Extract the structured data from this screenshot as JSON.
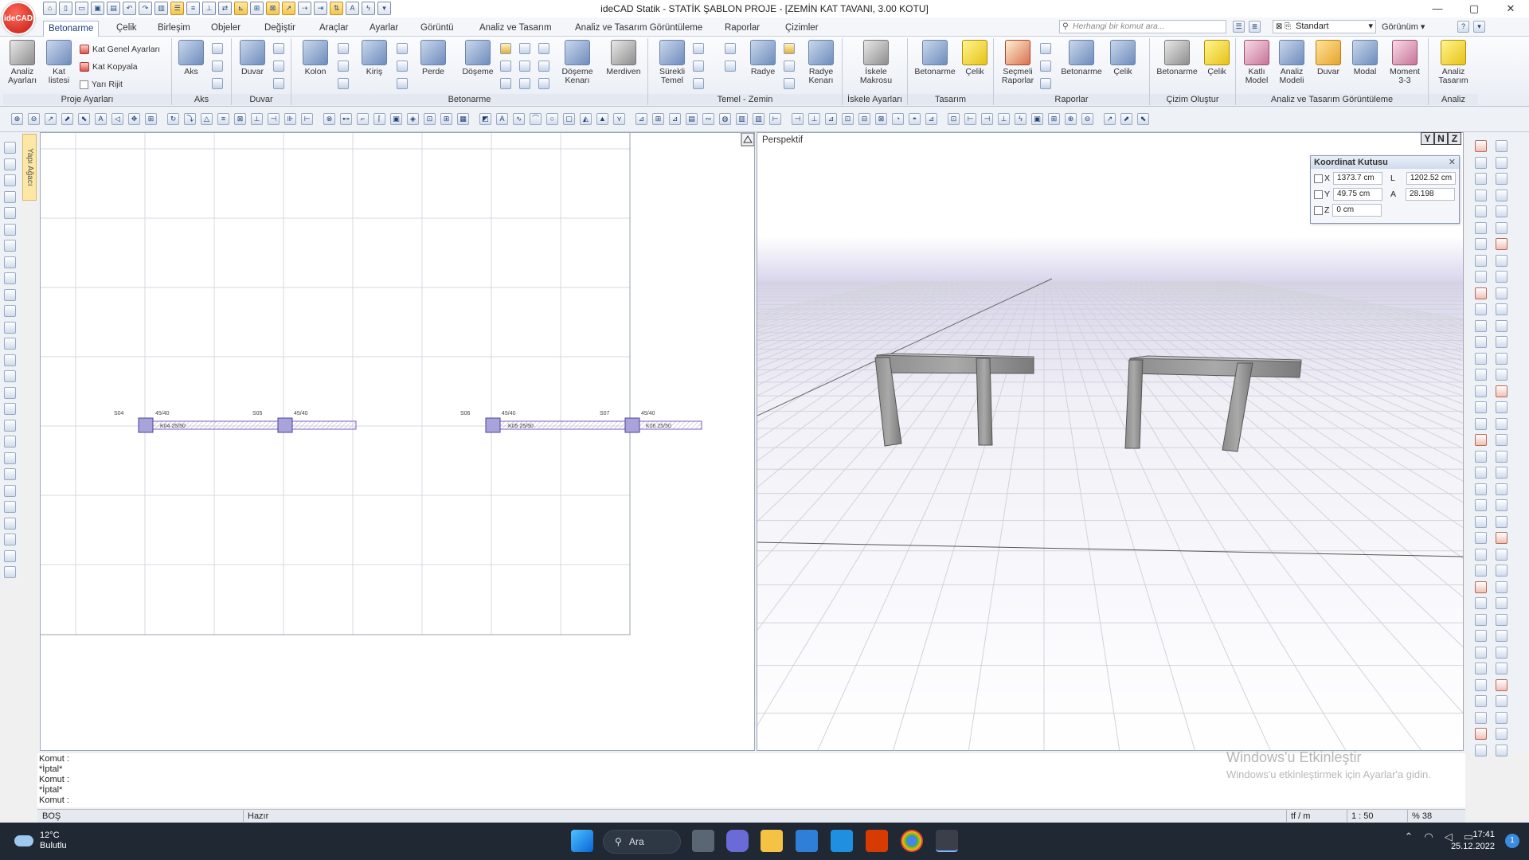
{
  "app": {
    "logo": "ideCAD",
    "title": "ideCAD Statik - STATİK ŞABLON PROJE - [ZEMİN KAT TAVANI,  3.00 KOTU]",
    "window_controls": [
      "—",
      "▢",
      "✕"
    ]
  },
  "tabs": [
    "Betonarme",
    "Çelik",
    "Birleşim",
    "Objeler",
    "Değiştir",
    "Araçlar",
    "Ayarlar",
    "Görüntü",
    "Analiz ve Tasarım",
    "Analiz ve Tasarım Görüntüleme",
    "Raporlar",
    "Çizimler"
  ],
  "search": {
    "placeholder": "Herhangi bir komut ara..."
  },
  "style_dropdown": {
    "value": "Standart"
  },
  "view_menu": {
    "label": "Görünüm"
  },
  "ribbon": {
    "proje": {
      "label": "Proje Ayarları",
      "analiz_ayarlari": [
        "Analiz",
        "Ayarları"
      ],
      "kat_listesi": [
        "Kat",
        "listesi"
      ],
      "kat_genel": "Kat Genel Ayarları",
      "kat_kopyala": "Kat Kopyala",
      "yari_rijit": "Yarı Rijit"
    },
    "aks": {
      "label": "Aks",
      "button": "Aks"
    },
    "duvar": {
      "label": "Duvar",
      "button": "Duvar"
    },
    "betonarme": {
      "label": "Betonarme",
      "kolon": "Kolon",
      "kiris": "Kiriş",
      "perde": "Perde",
      "doseme": "Döşeme",
      "doseme_kenari": [
        "Döşeme",
        "Kenarı"
      ],
      "merdiven": "Merdiven"
    },
    "temel": {
      "label": "Temel - Zemin",
      "surekli_temel": [
        "Sürekli",
        "Temel"
      ],
      "radye": "Radye",
      "radye_kenari": [
        "Radye",
        "Kenarı"
      ]
    },
    "iskele": {
      "label": "İskele Ayarları",
      "button": [
        "İskele",
        "Makrosu"
      ]
    },
    "tasarim": {
      "label": "Tasarım",
      "betonarme": "Betonarme",
      "celik": "Çelik"
    },
    "raporlar": {
      "label": "Raporlar",
      "secmeli": [
        "Seçmeli",
        "Raporlar"
      ],
      "betonarme": "Betonarme",
      "celik": "Çelik"
    },
    "cizim": {
      "label": "Çizim Oluştur",
      "betonarme": "Betonarme",
      "celik": "Çelik"
    },
    "analiz_gor": {
      "label": "Analiz ve Tasarım Görüntüleme",
      "katli_model": [
        "Katlı",
        "Model"
      ],
      "analiz_modeli": [
        "Analiz",
        "Modeli"
      ],
      "duvar": "Duvar",
      "modal": "Modal",
      "moment": [
        "Moment",
        "3-3"
      ]
    },
    "analiz": {
      "label": "Analiz",
      "button": [
        "Analiz",
        "Tasarım"
      ]
    }
  },
  "side_tab": "Yapı Ağacı",
  "plan": {
    "labels": [
      {
        "text": "S04",
        "kind": "col"
      },
      {
        "text": "45/40",
        "kind": "dim"
      },
      {
        "text": "S05",
        "kind": "col"
      },
      {
        "text": "45/40",
        "kind": "dim"
      },
      {
        "text": "S06",
        "kind": "col"
      },
      {
        "text": "45/40",
        "kind": "dim"
      },
      {
        "text": "S07",
        "kind": "col"
      },
      {
        "text": "45/40",
        "kind": "dim"
      }
    ],
    "beams": [
      "K04 25/50",
      "K05 25/50",
      "K06 25/50"
    ]
  },
  "perspective": {
    "label": "Perspektif",
    "view_buttons": [
      "Y",
      "N",
      "Z"
    ]
  },
  "coord_box": {
    "title": "Koordinat Kutusu",
    "close": "✕",
    "x_label": "X",
    "x_value": "1373.7 cm",
    "y_label": "Y",
    "y_value": "49.75 cm",
    "z_label": "Z",
    "z_value": "0 cm",
    "l_label": "L",
    "l_value": "1202.52 cm",
    "a_label": "A",
    "a_value": "28.198"
  },
  "command_log": [
    "Komut :",
    "*İptal*",
    "Komut :",
    "*İptal*",
    "Komut :"
  ],
  "watermark": {
    "title": "Windows'u Etkinleştir",
    "subtitle": "Windows'u etkinleştirmek için Ayarlar'a gidin."
  },
  "status": {
    "mode": "BOŞ",
    "state": "Hazır",
    "unit": "tf / m",
    "scale": "1 : 50",
    "zoom": "% 38"
  },
  "taskbar": {
    "temp": "12°C",
    "weather": "Bulutlu",
    "search": "Ara",
    "time": "17:41",
    "date": "25.12.2022",
    "notifications": "1"
  }
}
